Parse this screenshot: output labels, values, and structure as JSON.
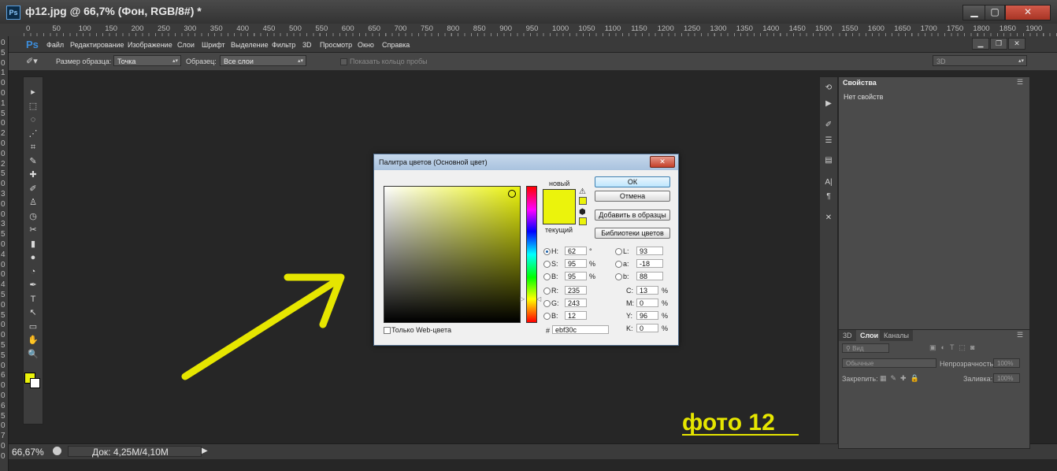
{
  "window": {
    "app_icon": "Ps",
    "title": "ф12.jpg @ 66,7% (Фон, RGB/8#) *",
    "min": "▁",
    "max": "▢",
    "close": "✕"
  },
  "ruler": {
    "top": [
      "0",
      "50",
      "100",
      "150",
      "200",
      "250",
      "300",
      "350",
      "400",
      "450",
      "500",
      "550",
      "600",
      "650",
      "700",
      "750",
      "800",
      "850",
      "900",
      "950",
      "1000",
      "1050",
      "1100",
      "1150",
      "1200",
      "1250",
      "1300",
      "1350",
      "1400",
      "1450",
      "1500",
      "1550",
      "1600",
      "1650",
      "1700",
      "1750",
      "1800",
      "1850",
      "1900"
    ],
    "left": [
      "0",
      "5",
      "0",
      "1",
      "0",
      "0",
      "1",
      "5",
      "0",
      "2",
      "0",
      "0",
      "2",
      "5",
      "0",
      "3",
      "0",
      "0",
      "3",
      "5",
      "0",
      "4",
      "0",
      "0",
      "4",
      "5",
      "0",
      "5",
      "0",
      "0",
      "5",
      "5",
      "0",
      "6",
      "0",
      "0",
      "6",
      "5",
      "0",
      "7",
      "0",
      "0"
    ]
  },
  "menubar": {
    "logo": "Ps",
    "items": [
      "Файл",
      "Редактирование",
      "Изображение",
      "Слои",
      "Шрифт",
      "Выделение",
      "Фильтр",
      "3D",
      "Просмотр",
      "Окно",
      "Справка"
    ],
    "btn_min": "▁",
    "btn_restore": "❐",
    "btn_close": "✕"
  },
  "options": {
    "sample_size_label": "Размер образца:",
    "sample_size_value": "Точка",
    "sample_label": "Образец:",
    "sample_value": "Все слои",
    "show_ring_label": "Показать кольцо пробы",
    "workspace_value": "3D"
  },
  "tools": [
    "▸",
    "⬚",
    "◌",
    "⋰",
    "⌗",
    "✎",
    "✚",
    "✐",
    "♙",
    "◷",
    "✂",
    "▮",
    "●",
    "◔",
    "✒",
    "T",
    "↖",
    "▭",
    "✋",
    "🔍"
  ],
  "status": {
    "zoom": "66,67%",
    "doc": "Док: 4,25M/4,10M",
    "arrow": "▶"
  },
  "properties_panel": {
    "tab": "Свойства",
    "content": "Нет свойств"
  },
  "layers_panel": {
    "tabs": [
      "3D",
      "Слои",
      "Каналы"
    ],
    "filter_label": "Вид",
    "blend_mode": "Обычные",
    "opacity_label": "Непрозрачность:",
    "opacity_value": "100%",
    "lock_label": "Закрепить:",
    "fill_label": "Заливка:",
    "fill_value": "100%"
  },
  "dialog": {
    "title": "Палитра цветов (Основной цвет)",
    "close": "✕",
    "new_label": "новый",
    "current_label": "текущий",
    "ok": "ОК",
    "cancel": "Отмена",
    "add_swatch": "Добавить в образцы",
    "libraries": "Библиотеки цветов",
    "web_only": "Только Web-цвета",
    "hex_label": "#",
    "hex": "ebf30c",
    "hsb": [
      {
        "label": "H:",
        "value": "62",
        "unit": "°"
      },
      {
        "label": "S:",
        "value": "95",
        "unit": "%"
      },
      {
        "label": "B:",
        "value": "95",
        "unit": "%"
      }
    ],
    "rgb": [
      {
        "label": "R:",
        "value": "235"
      },
      {
        "label": "G:",
        "value": "243"
      },
      {
        "label": "B:",
        "value": "12"
      }
    ],
    "lab": [
      {
        "label": "L:",
        "value": "93"
      },
      {
        "label": "a:",
        "value": "-18"
      },
      {
        "label": "b:",
        "value": "88"
      }
    ],
    "cmyk": [
      {
        "label": "C:",
        "value": "13",
        "unit": "%"
      },
      {
        "label": "M:",
        "value": "0",
        "unit": "%"
      },
      {
        "label": "Y:",
        "value": "96",
        "unit": "%"
      },
      {
        "label": "K:",
        "value": "0",
        "unit": "%"
      }
    ],
    "color": "#ebf30c"
  },
  "annotation": {
    "label": "фото 12",
    "color": "#e6e600"
  }
}
